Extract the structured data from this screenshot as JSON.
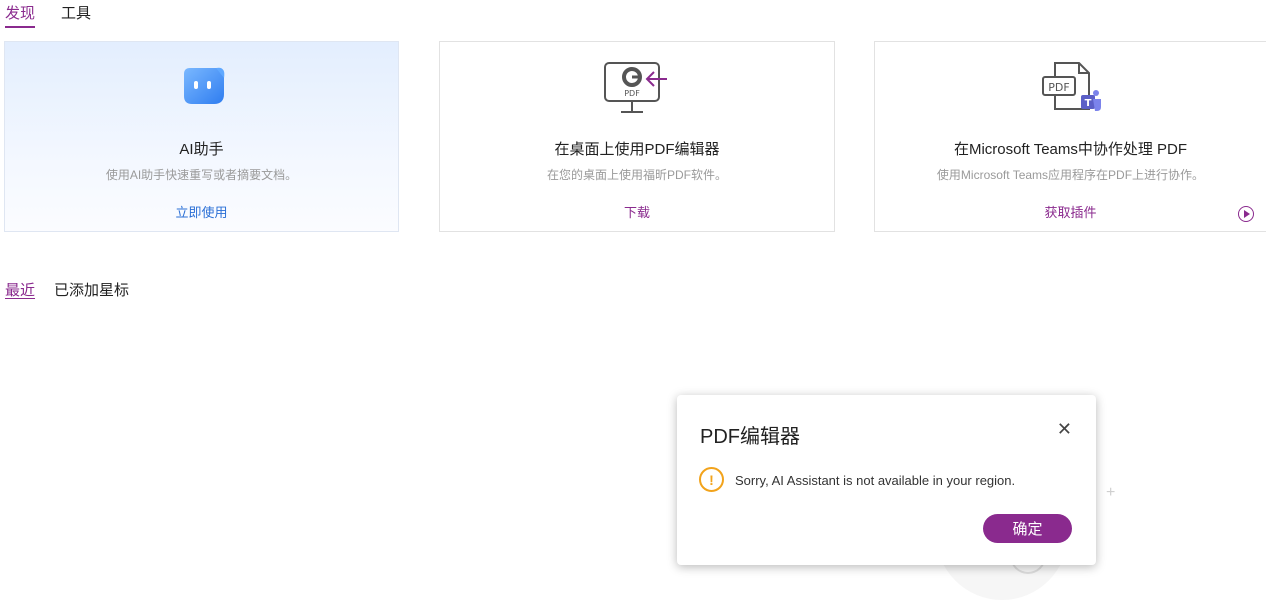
{
  "top_tabs": [
    {
      "label": "发现",
      "active": true
    },
    {
      "label": "工具",
      "active": false
    }
  ],
  "cards": [
    {
      "icon": "ai-assistant-icon",
      "title": "AI助手",
      "description": "使用AI助手快速重写或者摘要文档。",
      "link": "立即使用"
    },
    {
      "icon": "desktop-pdf-icon",
      "title": "在桌面上使用PDF编辑器",
      "description": "在您的桌面上使用福昕PDF软件。",
      "link": "下载",
      "icon_text": "PDF"
    },
    {
      "icon": "teams-pdf-icon",
      "title": "在Microsoft Teams中协作处理 PDF",
      "description": "使用Microsoft Teams应用程序在PDF上进行协作。",
      "link": "获取插件",
      "icon_text": "PDF"
    }
  ],
  "recent_tabs": [
    {
      "label": "最近",
      "active": true
    },
    {
      "label": "已添加星标",
      "active": false
    }
  ],
  "dialog": {
    "title": "PDF编辑器",
    "message": "Sorry, AI Assistant is not available in your region.",
    "ok_label": "确定"
  },
  "colors": {
    "accent": "#8a2a8e",
    "link_blue": "#2a6fd6",
    "warning": "#f2a31b"
  }
}
